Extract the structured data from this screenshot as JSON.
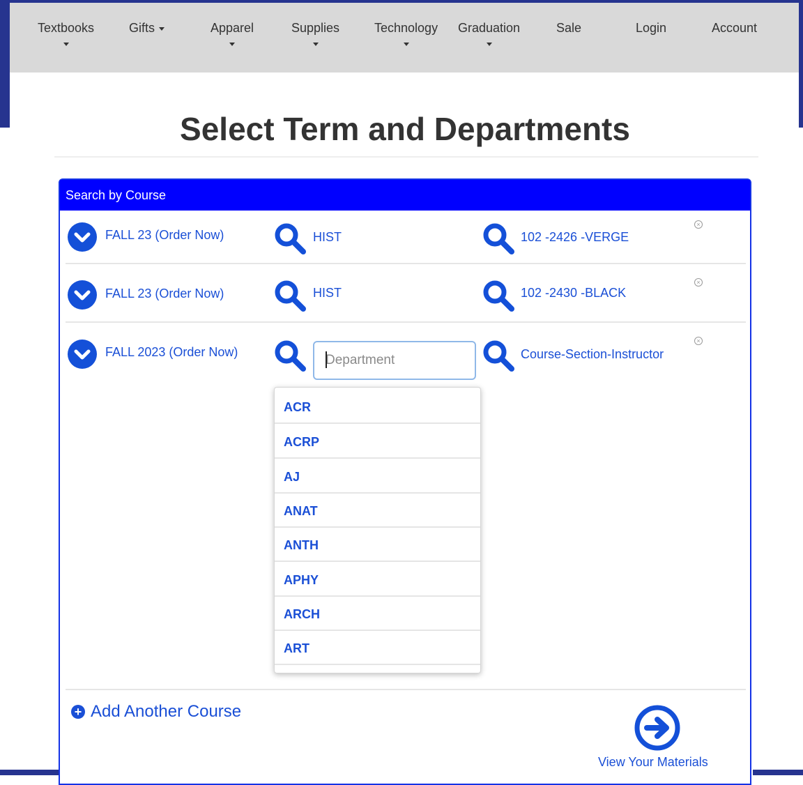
{
  "nav": {
    "items": [
      {
        "label": "Textbooks",
        "has_dropdown": true
      },
      {
        "label": "Gifts",
        "has_dropdown": true
      },
      {
        "label": "Apparel",
        "has_dropdown": true
      },
      {
        "label": "Supplies",
        "has_dropdown": true
      },
      {
        "label": "Technology",
        "has_dropdown": true
      },
      {
        "label": "Graduation",
        "has_dropdown": true
      },
      {
        "label": "Sale",
        "has_dropdown": false
      },
      {
        "label": "Login",
        "has_dropdown": false
      },
      {
        "label": "Account",
        "has_dropdown": false
      }
    ]
  },
  "page_title": "Select Term and Departments",
  "panel": {
    "heading": "Search by Course",
    "rows": [
      {
        "term": "FALL 23 (Order Now)",
        "department": "HIST",
        "course": "102 -2426 -VERGE"
      },
      {
        "term": "FALL 23 (Order Now)",
        "department": "HIST",
        "course": "102 -2430 -BLACK"
      },
      {
        "term": "FALL 2023 (Order Now)",
        "department_placeholder": "Department",
        "course": "Course-Section-Instructor"
      }
    ],
    "department_options": [
      "ACR",
      "ACRP",
      "AJ",
      "ANAT",
      "ANTH",
      "APHY",
      "ARCH",
      "ART"
    ],
    "add_course_label": "Add Another Course",
    "view_materials_label": "View Your Materials"
  },
  "colors": {
    "frame": "#26348f",
    "navbar": "#d9d9d9",
    "panel_heading": "#0000ff",
    "link": "#1a4fd6",
    "icon_blue": "#1450d8"
  },
  "icons": {
    "term_toggle": "chevron-down-circle-icon",
    "search": "magnifier-icon",
    "remove": "close-circle-icon",
    "add": "plus-circle-icon",
    "view": "arrow-right-circle-icon"
  }
}
